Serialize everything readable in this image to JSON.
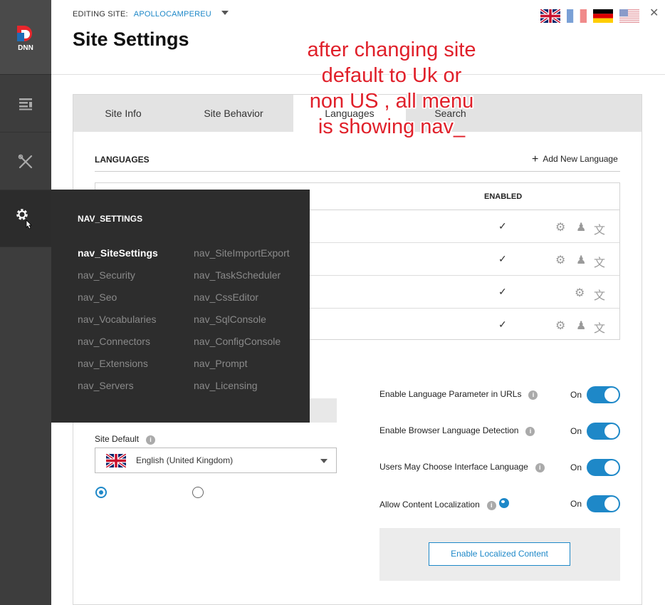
{
  "header": {
    "editing_label": "EDITING SITE:",
    "site_name": "APOLLOCAMPEREU",
    "title": "Site Settings",
    "flags": [
      "gb-flag",
      "fr-flag",
      "de-flag",
      "us-flag"
    ]
  },
  "sidebar": {
    "logo": "dnn",
    "items": [
      "pages-icon",
      "tools-icon",
      "settings-icon"
    ]
  },
  "tabs": [
    "Site Info",
    "Site Behavior",
    "Languages",
    "Search"
  ],
  "languages": {
    "section_title": "LANGUAGES",
    "add_label": "Add New Language",
    "col_enabled": "ENABLED",
    "rows": [
      {
        "enabled": "✓"
      },
      {
        "enabled": "✓"
      },
      {
        "enabled": "✓"
      },
      {
        "enabled": "✓"
      }
    ]
  },
  "site_default": {
    "label": "Site Default",
    "value": "English (United Kingdom)"
  },
  "settings": [
    {
      "label": "Enable Language Parameter in URLs",
      "state": "On"
    },
    {
      "label": "Enable Browser Language Detection",
      "state": "On"
    },
    {
      "label": "Users May Choose Interface Language",
      "state": "On"
    },
    {
      "label": "Allow Content Localization",
      "state": "On"
    }
  ],
  "localized_button": "Enable Localized Content",
  "nav": {
    "title": "NAV_SETTINGS",
    "left": [
      "nav_SiteSettings",
      "nav_Security",
      "nav_Seo",
      "nav_Vocabularies",
      "nav_Connectors",
      "nav_Extensions",
      "nav_Servers"
    ],
    "right": [
      "nav_SiteImportExport",
      "nav_TaskScheduler",
      "nav_CssEditor",
      "nav_SqlConsole",
      "nav_ConfigConsole",
      "nav_Prompt",
      "nav_Licensing"
    ]
  },
  "annotation": {
    "lines": [
      "after changing site",
      "default to Uk or",
      "non US , all menu",
      "is showing nav_"
    ]
  },
  "colors": {
    "accent": "#1e88c8",
    "sidebar": "#3d3d3d",
    "flyout": "#2d2d2d",
    "annotation": "#e0202a"
  }
}
